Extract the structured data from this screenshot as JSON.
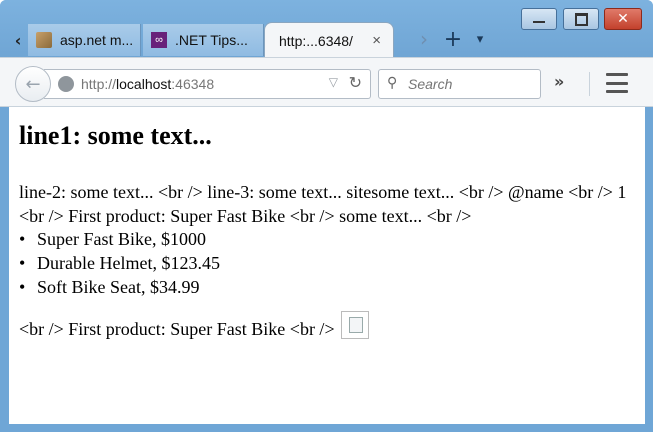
{
  "tabs": [
    {
      "label": "asp.net m...",
      "favicon": "aspnet-icon",
      "active": false
    },
    {
      "label": ".NET Tips...",
      "favicon": "visual-studio-icon",
      "active": false
    },
    {
      "label": "http:...6348/",
      "favicon": "",
      "active": true,
      "close": "×"
    }
  ],
  "tabbar": {
    "scroll_left": "‹",
    "scroll_right": "›",
    "new_tab": "+",
    "list_all": "▾"
  },
  "window_controls": {
    "minimize": "–",
    "restore": "▫",
    "close": "✕"
  },
  "nav": {
    "back": "←",
    "url_prefix": "http://",
    "url_host": "localhost",
    "url_port": ":46348",
    "search_placeholder": "Search",
    "overflow": "»"
  },
  "page": {
    "heading": "line1: some text...",
    "para1": "line-2: some text... <br /> line-3: some text... sitesome text... <br /> @name <br /> 1 <br /> First product: Super Fast Bike <br /> some text... <br />",
    "products": [
      "Super Fast Bike, $1000",
      "Durable Helmet, $123.45",
      "Soft Bike Seat, $34.99"
    ],
    "para2": "<br /> First product: Super Fast Bike <br />"
  },
  "colors": {
    "frame": "#6fa6d6",
    "toolbar": "#f4f6f8",
    "vs_purple": "#68217a"
  }
}
